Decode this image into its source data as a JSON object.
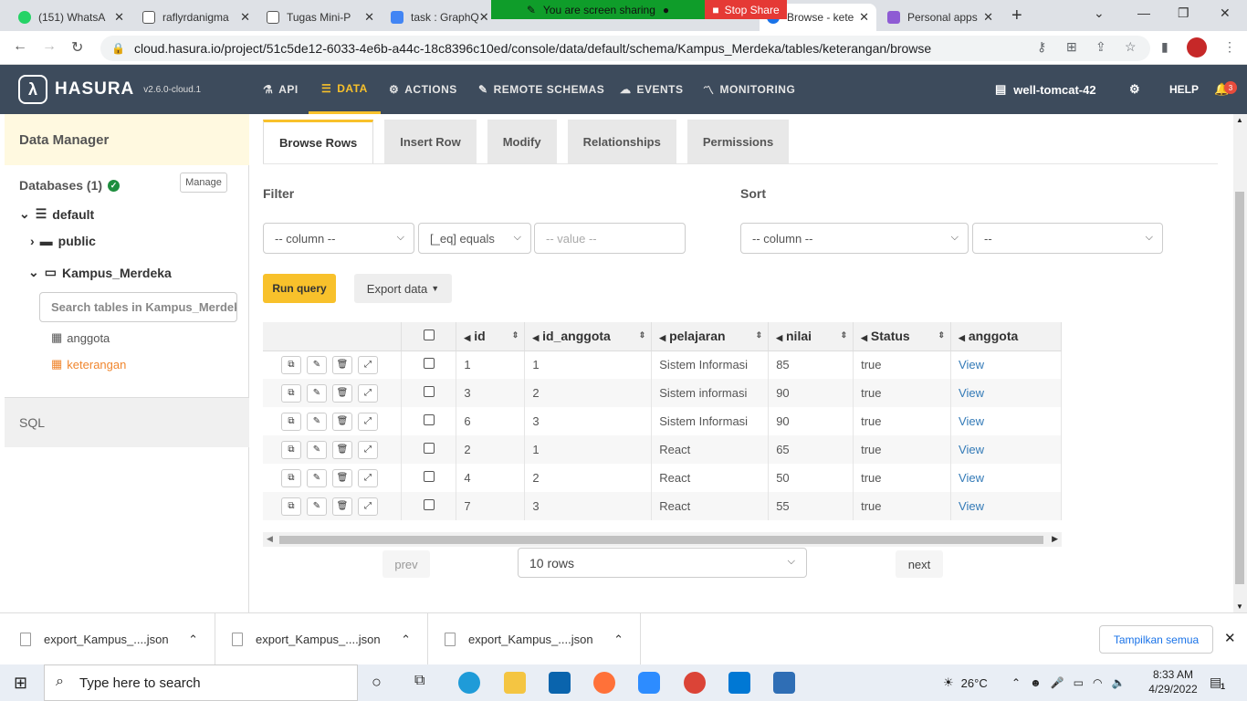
{
  "browser": {
    "tabs": [
      {
        "title": "(151) WhatsA",
        "color": "#25d366"
      },
      {
        "title": "raflyrdanigma",
        "color": "#333"
      },
      {
        "title": "Tugas Mini-P",
        "color": "#333"
      },
      {
        "title": "task : GraphQ",
        "color": "#4285f4"
      },
      {
        "title": "Browse - kete",
        "color": "#1a73e8"
      },
      {
        "title": "Personal apps",
        "color": "#8e5bd4"
      }
    ],
    "sharing_text": "You are screen sharing",
    "stop_share": "Stop Share",
    "url": "cloud.hasura.io/project/51c5de12-6033-4e6b-a44c-18c8396c10ed/console/data/default/schema/Kampus_Merdeka/tables/keterangan/browse"
  },
  "header": {
    "brand": "HASURA",
    "version": "v2.6.0-cloud.1",
    "nav": [
      {
        "label": "API",
        "icon": "flask-icon"
      },
      {
        "label": "DATA",
        "icon": "database-icon"
      },
      {
        "label": "ACTIONS",
        "icon": "gears-icon"
      },
      {
        "label": "REMOTE SCHEMAS",
        "icon": "plug-icon"
      },
      {
        "label": "EVENTS",
        "icon": "cloud-icon"
      },
      {
        "label": "MONITORING",
        "icon": "chart-icon"
      }
    ],
    "project": "well-tomcat-42",
    "help": "HELP",
    "notifications": "3"
  },
  "sidebar": {
    "title": "Data Manager",
    "databases": "Databases (1)",
    "manage": "Manage",
    "db": "default",
    "schema_public": "public",
    "schema_active": "Kampus_Merdeka",
    "search_placeholder": "Search tables in Kampus_Merdeka",
    "tables": [
      "anggota",
      "keterangan"
    ],
    "sql": "SQL"
  },
  "main": {
    "tabs": [
      "Browse Rows",
      "Insert Row",
      "Modify",
      "Relationships",
      "Permissions"
    ],
    "filter_label": "Filter",
    "sort_label": "Sort",
    "filter_column": "-- column --",
    "filter_op": "[_eq] equals",
    "filter_value_placeholder": "-- value --",
    "sort_column": "-- column --",
    "sort_dir": "--",
    "run_query": "Run query",
    "export_data": "Export data",
    "columns": [
      "id",
      "id_anggota",
      "pelajaran",
      "nilai",
      "Status",
      "anggota"
    ],
    "rows": [
      [
        "1",
        "1",
        "Sistem Informasi",
        "85",
        "true",
        "View"
      ],
      [
        "3",
        "2",
        "Sistem informasi",
        "90",
        "true",
        "View"
      ],
      [
        "6",
        "3",
        "Sistem Informasi",
        "90",
        "true",
        "View"
      ],
      [
        "2",
        "1",
        "React",
        "65",
        "true",
        "View"
      ],
      [
        "4",
        "2",
        "React",
        "50",
        "true",
        "View"
      ],
      [
        "7",
        "3",
        "React",
        "55",
        "true",
        "View"
      ]
    ],
    "prev": "prev",
    "next": "next",
    "rows_per_page": "10 rows"
  },
  "downloads": {
    "files": [
      "export_Kampus_....json",
      "export_Kampus_....json",
      "export_Kampus_....json"
    ],
    "show_all": "Tampilkan semua"
  },
  "taskbar": {
    "search": "Type here to search",
    "weather": "26°C",
    "time": "8:33 AM",
    "date": "4/29/2022",
    "notif_count": "1"
  }
}
